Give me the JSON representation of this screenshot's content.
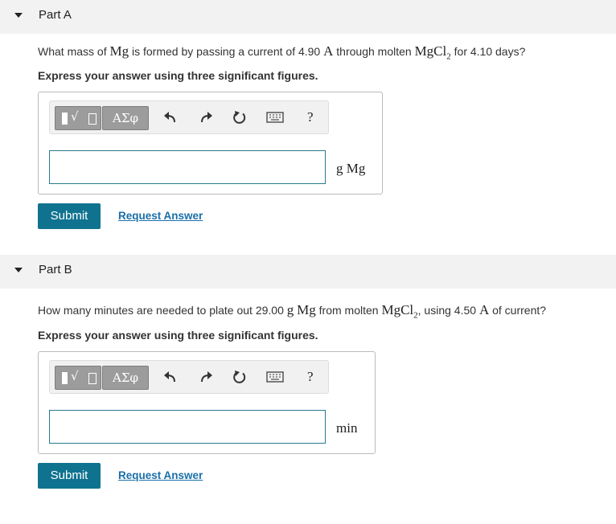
{
  "toolbar": {
    "templates_icon": "radical-template-icon",
    "symbols_label": "ΑΣφ",
    "undo_icon": "undo-icon",
    "redo_icon": "redo-icon",
    "reset_icon": "reset-icon",
    "keyboard_icon": "keyboard-icon",
    "help_label": "?"
  },
  "partA": {
    "title": "Part A",
    "q_pre": "What mass of ",
    "q_mg": "Mg",
    "q_mid1": " is formed by passing a current of 4.90 ",
    "q_amp": "A",
    "q_mid2": " through molten ",
    "q_mgcl_main": "MgCl",
    "q_mgcl_sub": "2",
    "q_post": " for 4.10 days?",
    "instruction": "Express your answer using three significant figures.",
    "answer_value": "",
    "unit": "g Mg",
    "submit_label": "Submit",
    "request_label": "Request Answer"
  },
  "partB": {
    "title": "Part B",
    "q_pre": "How many minutes are needed to plate out 29.00 ",
    "q_g": "g",
    "q_mg": "Mg",
    "q_mid1": " from molten ",
    "q_mgcl_main": "MgCl",
    "q_mgcl_sub": "2",
    "q_mid2": ", using 4.50 ",
    "q_amp": "A",
    "q_post": " of current?",
    "instruction": "Express your answer using three significant figures.",
    "answer_value": "",
    "unit": "min",
    "submit_label": "Submit",
    "request_label": "Request Answer"
  },
  "colors": {
    "accent": "#0f7390",
    "link": "#1a6fa8",
    "header_bg": "#f2f2f2"
  }
}
